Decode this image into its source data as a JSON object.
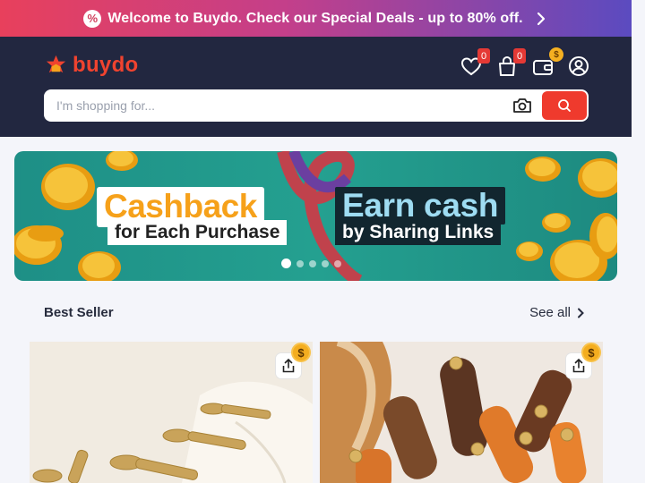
{
  "promo": {
    "badge_symbol": "%",
    "text": "Welcome to Buydo. Check our Special Deals - up to 80% off."
  },
  "brand": {
    "name": "buydo",
    "color": "#f0432f"
  },
  "header": {
    "wishlist_count": "0",
    "cart_count": "0",
    "wallet_badge": "$"
  },
  "search": {
    "placeholder": "I'm shopping for..."
  },
  "banner": {
    "cashback_title": "Cashback",
    "cashback_sub": "for Each Purchase",
    "earn_title": "Earn cash",
    "earn_sub": "by Sharing Links",
    "slides": 5,
    "active_slide": 1
  },
  "best_seller": {
    "title": "Best Seller",
    "see_all": "See all",
    "products": [
      {
        "name": "brass-handles",
        "coin": "$"
      },
      {
        "name": "leather-straps",
        "coin": "$"
      }
    ]
  },
  "colors": {
    "header_bg": "#222740",
    "accent": "#ef3a2d",
    "coin": "#f4ad1f"
  }
}
